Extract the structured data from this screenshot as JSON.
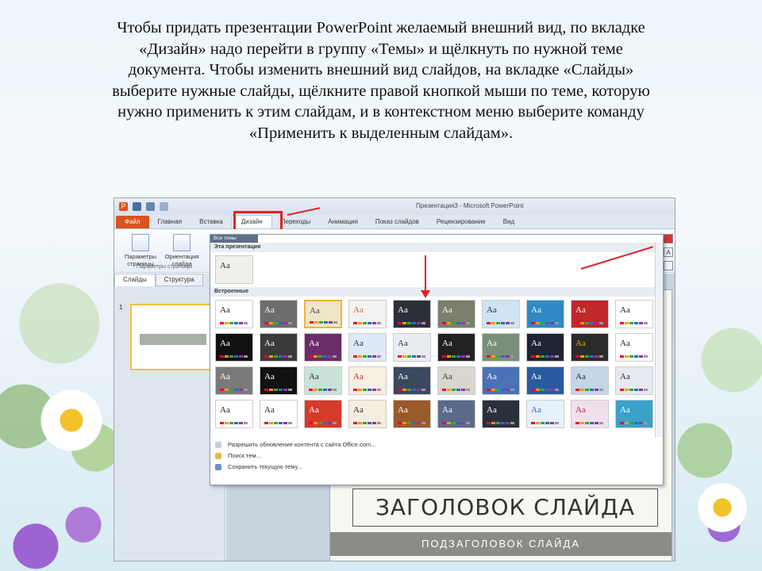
{
  "caption": {
    "lines": [
      "Чтобы придать презентации PowerPoint желаемый внешний вид, по вкладке",
      "«Дизайн» надо перейти в группу «Темы» и щёлкнуть по нужной теме",
      "документа. Чтобы изменить внешний вид слайдов, на вкладке «Слайды»",
      "выберите нужные слайды, щёлкните правой кнопкой мыши по теме, которую",
      "нужно применить к этим слайдам, и в контекстном меню выберите команду",
      "«Применить к выделенным слайдам»."
    ]
  },
  "window": {
    "title": "Презентация3 - Microsoft PowerPoint"
  },
  "tabs": [
    "Файл",
    "Главная",
    "Вставка",
    "Дизайн",
    "Переходы",
    "Анимация",
    "Показ слайдов",
    "Рецензирование",
    "Вид"
  ],
  "ribbon": {
    "page_setup": "Параметры страницы",
    "orientation": "Ориентация слайда",
    "group_label": "Параметры страницы"
  },
  "pane": {
    "tabs": [
      "Слайды",
      "Структура"
    ],
    "slide_number": "1"
  },
  "gallery": {
    "header": "Все темы",
    "this_presentation": "Эта презентация",
    "builtin": "Встроенные",
    "theme_sample": "Aa",
    "menu": [
      "Разрешить обновление контента с сайта Office.com...",
      "Поиск тем...",
      "Сохранить текущую тему..."
    ]
  },
  "slide": {
    "title": "ЗАГОЛОВОК СЛАЙДА",
    "subtitle": "ПОДЗАГОЛОВОК СЛАЙДА"
  },
  "colors": {
    "accent_red": "#e02323",
    "file_tab": "#d9541e",
    "selection": "#f0b33a"
  }
}
